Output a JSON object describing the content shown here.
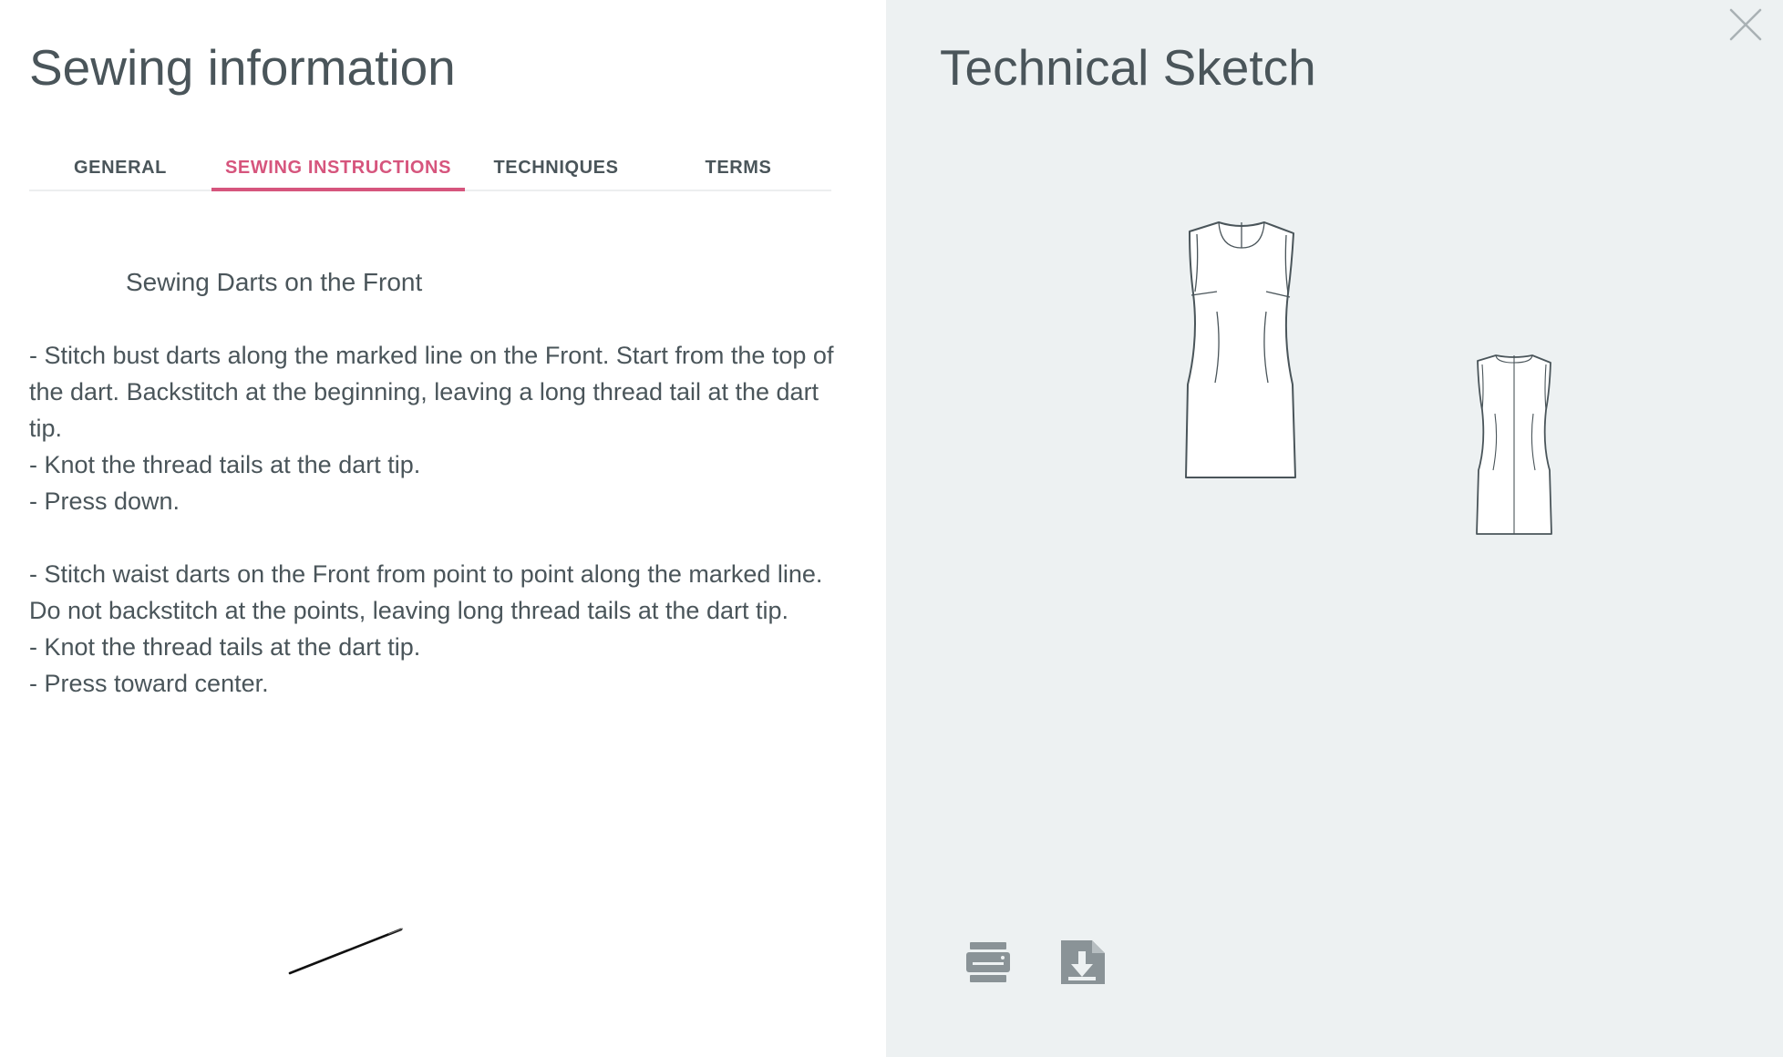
{
  "left_panel": {
    "title": "Sewing information",
    "tabs": [
      {
        "label": "GENERAL"
      },
      {
        "label": "SEWING INSTRUCTIONS"
      },
      {
        "label": "TECHNIQUES"
      },
      {
        "label": "TERMS"
      }
    ],
    "active_tab": "SEWING INSTRUCTIONS",
    "section_heading": "Sewing Darts on the Front",
    "paragraphs": [
      "- Stitch bust darts along the marked line on the Front. Start from the top of the dart. Backstitch at the beginning, leaving a long thread tail at the dart tip.\n- Knot the thread tails at the dart tip.\n- Press down.",
      "- Stitch waist darts on the Front from point to point along the marked line. Do not backstitch at the points, leaving long thread tails at the dart tip.\n- Knot the thread tails at the dart tip.\n- Press toward center."
    ]
  },
  "right_panel": {
    "title": "Technical Sketch",
    "close_icon": "close-icon",
    "sketches": [
      "front-dress-sketch",
      "back-dress-sketch"
    ],
    "actions": [
      {
        "icon": "print-icon"
      },
      {
        "icon": "download-icon"
      }
    ]
  },
  "colors": {
    "accent": "#d6557d",
    "text": "#4a555a",
    "right_bg": "#edf1f2",
    "icon": "#8a9397",
    "sketch_stroke": "#4a555a"
  }
}
